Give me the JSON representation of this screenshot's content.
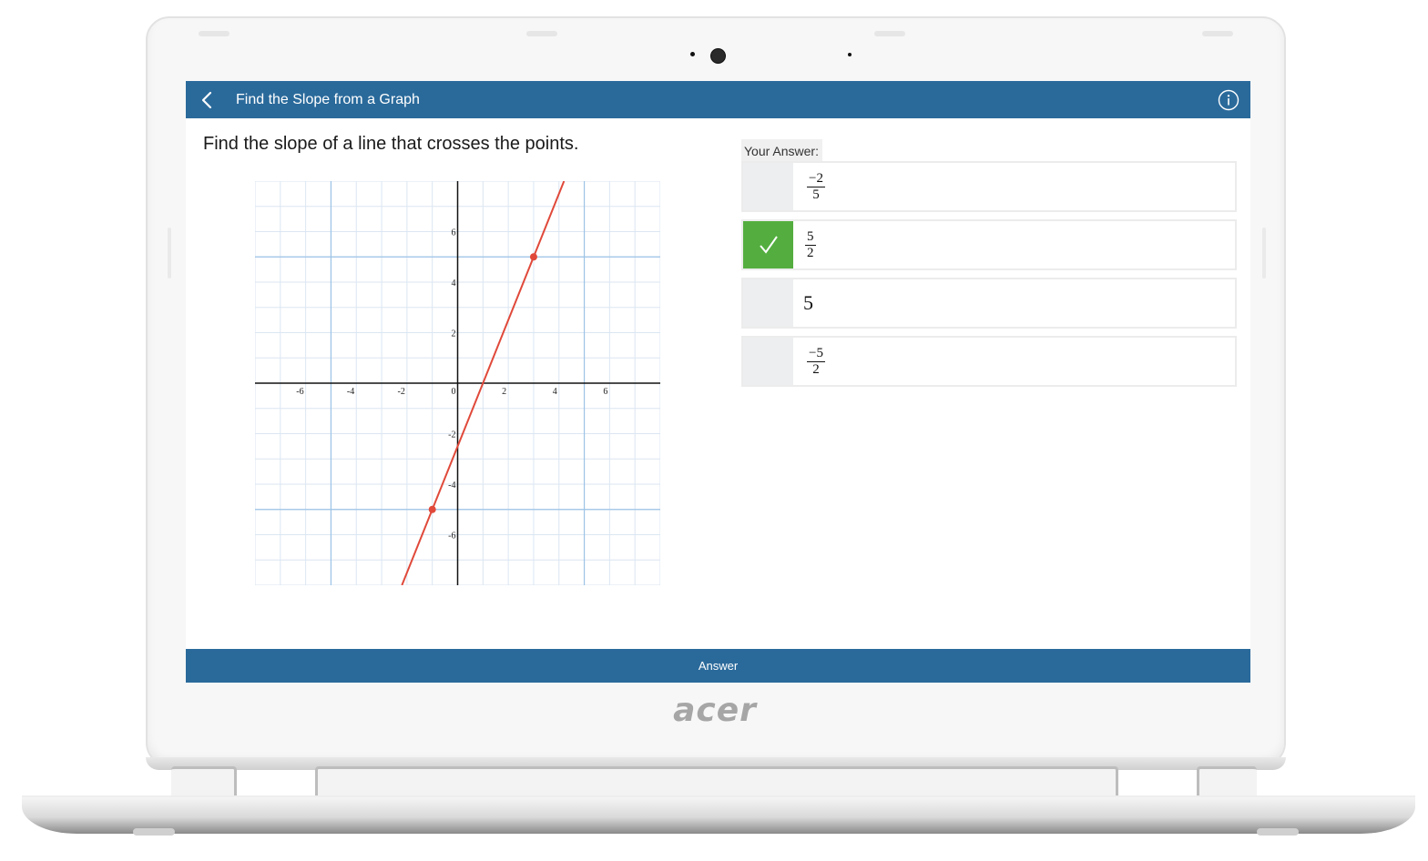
{
  "header": {
    "title": "Find the Slope from a Graph"
  },
  "question": {
    "text": "Find the slope of a line that crosses the points."
  },
  "answers": {
    "label": "Your Answer:",
    "options": [
      {
        "type": "fraction",
        "num": "−2",
        "den": "5",
        "selected": false
      },
      {
        "type": "fraction",
        "num": "5",
        "den": "2",
        "selected": true
      },
      {
        "type": "integer",
        "text": "5",
        "selected": false
      },
      {
        "type": "fraction",
        "num": "−5",
        "den": "2",
        "selected": false
      }
    ]
  },
  "footer": {
    "answer_label": "Answer"
  },
  "device": {
    "brand": "acer"
  },
  "colors": {
    "header": "#2a6a9b",
    "correct": "#53ae3f",
    "line": "#e0493a"
  },
  "chart_data": {
    "type": "line",
    "xlim": [
      -8,
      8
    ],
    "ylim": [
      -8,
      8
    ],
    "x_ticks": [
      -6,
      -4,
      -2,
      0,
      2,
      4,
      6
    ],
    "y_ticks": [
      -6,
      -4,
      -2,
      2,
      4,
      6
    ],
    "x_tick_labels": [
      "-6",
      "-4",
      "-2",
      "0",
      "2",
      "4",
      "6"
    ],
    "y_tick_labels": [
      "-6",
      "-4",
      "-2",
      "2",
      "4",
      "6"
    ],
    "grid": true,
    "minor_grid_step": 1,
    "highlight_x": [
      -5,
      5
    ],
    "highlight_y": [
      -5,
      5
    ],
    "line": {
      "slope": 2.5,
      "intercept": -2.5
    },
    "points": [
      {
        "x": -1,
        "y": -5
      },
      {
        "x": 3,
        "y": 5
      }
    ]
  }
}
